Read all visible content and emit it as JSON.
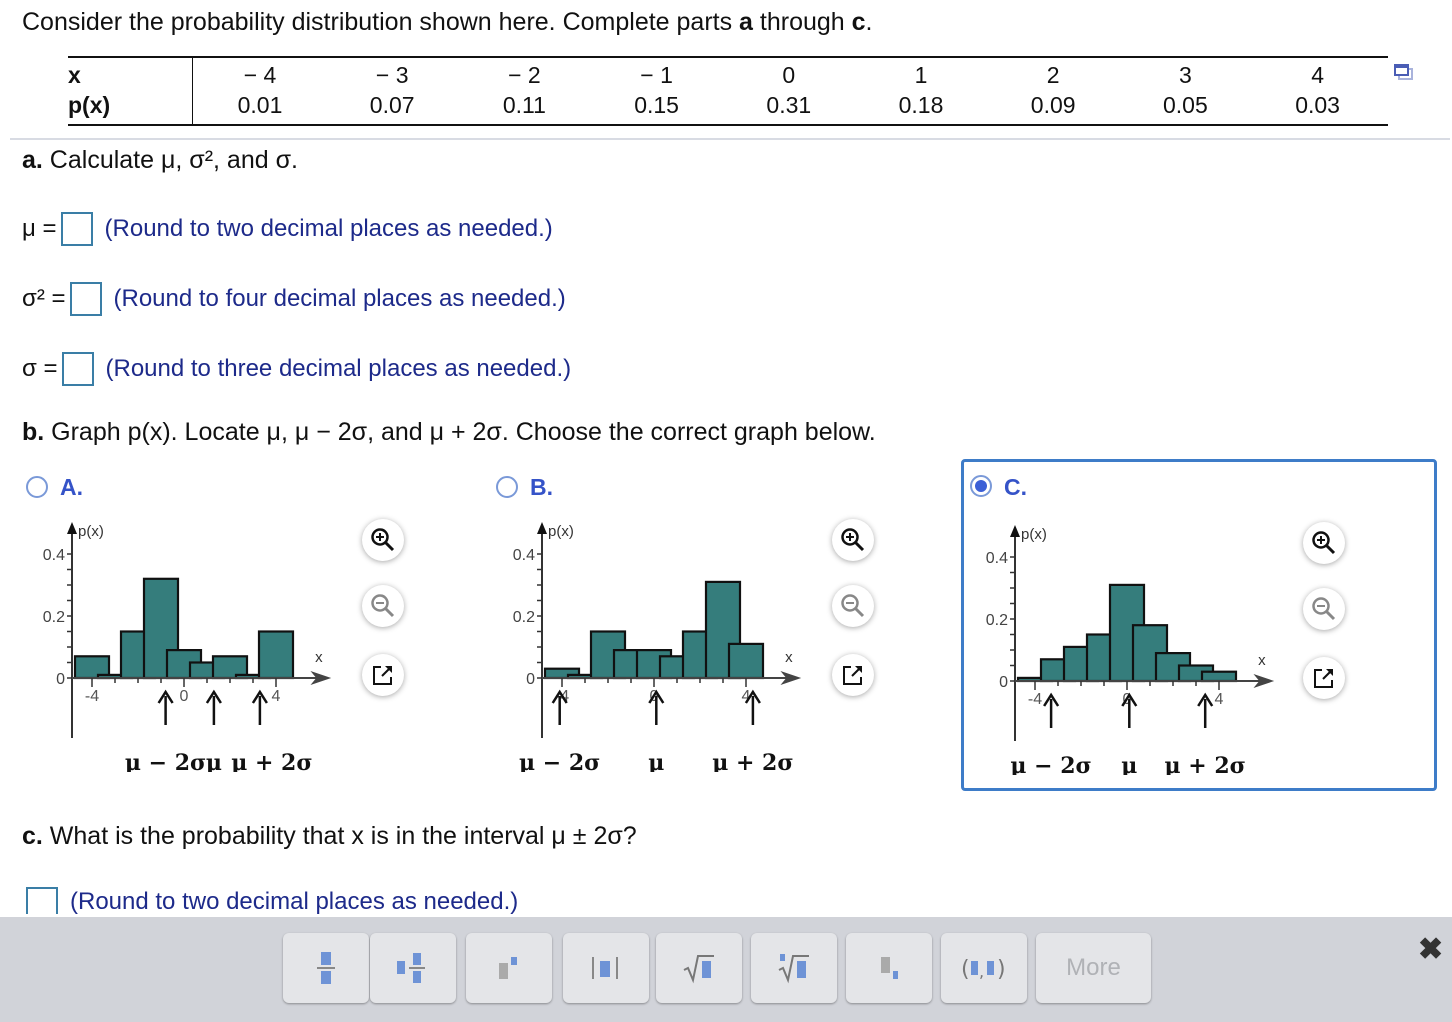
{
  "prompt": {
    "text_pre": "Consider the probability distribution shown here. Complete parts ",
    "a": "a",
    "mid": " through ",
    "c": "c",
    "end": "."
  },
  "table": {
    "x_header": "x",
    "p_header": "p(x)",
    "x_values": [
      "− 4",
      "− 3",
      "− 2",
      "− 1",
      "0",
      "1",
      "2",
      "3",
      "4"
    ],
    "p_values": [
      "0.01",
      "0.07",
      "0.11",
      "0.15",
      "0.31",
      "0.18",
      "0.09",
      "0.05",
      "0.03"
    ]
  },
  "part_a": {
    "label": "a.",
    "text": " Calculate μ, σ², and σ.",
    "rows": [
      {
        "label": "μ =",
        "value": "",
        "hint": "(Round to two decimal places as needed.)"
      },
      {
        "label": "σ² =",
        "value": "",
        "hint": "(Round to four decimal places as needed.)"
      },
      {
        "label": "σ =",
        "value": "",
        "hint": "(Round to three decimal places as needed.)"
      }
    ]
  },
  "part_b": {
    "label": "b.",
    "text": " Graph p(x). Locate μ, μ − 2σ, and μ + 2σ. Choose the correct graph below.",
    "selected": "C",
    "options": [
      {
        "letter": "A.",
        "selected": false
      },
      {
        "letter": "B.",
        "selected": false
      },
      {
        "letter": "C.",
        "selected": true
      }
    ]
  },
  "chart_data": [
    {
      "type": "bar",
      "title": "Option A",
      "categories": [
        -4,
        -3,
        -2,
        -1,
        0,
        1,
        2,
        3,
        4
      ],
      "values": [
        0.07,
        0.01,
        0.15,
        0.32,
        0.09,
        0.05,
        0.07,
        0.01,
        0.15
      ],
      "xlabel": "x",
      "ylabel": "p(x)",
      "ylim": [
        0,
        0.4
      ],
      "yticks": [
        "0",
        "0.2",
        "0.4"
      ],
      "xticks": [
        "-4",
        "0",
        "4"
      ],
      "markers": [
        {
          "label": "μ − 2σ",
          "x": -0.8
        },
        {
          "label": "μ",
          "x": 1.3
        },
        {
          "label": "μ + 2σ",
          "x": 3.3
        }
      ],
      "marker_caption": "μ − 2σ    μ μ + 2σ"
    },
    {
      "type": "bar",
      "title": "Option B",
      "categories": [
        -4,
        -3,
        -2,
        -1,
        0,
        1,
        2,
        3,
        4
      ],
      "values": [
        0.03,
        0.01,
        0.15,
        0.09,
        0.09,
        0.07,
        0.15,
        0.31,
        0.11
      ],
      "xlabel": "x",
      "ylabel": "p(x)",
      "ylim": [
        0,
        0.4
      ],
      "yticks": [
        "0",
        "0.2",
        "0.4"
      ],
      "xticks": [
        "-4",
        "0",
        "4"
      ],
      "markers": [
        {
          "label": "μ − 2σ",
          "x": -4.1
        },
        {
          "label": "μ",
          "x": 0.1
        },
        {
          "label": "μ + 2σ",
          "x": 4.3
        }
      ]
    },
    {
      "type": "bar",
      "title": "Option C",
      "categories": [
        -4,
        -3,
        -2,
        -1,
        0,
        1,
        2,
        3,
        4
      ],
      "values": [
        0.01,
        0.07,
        0.11,
        0.15,
        0.31,
        0.18,
        0.09,
        0.05,
        0.03
      ],
      "xlabel": "x",
      "ylabel": "p(x)",
      "ylim": [
        0,
        0.4
      ],
      "yticks": [
        "0",
        "0.2",
        "0.4"
      ],
      "xticks": [
        "-4",
        "0",
        "4"
      ],
      "markers": [
        {
          "label": "μ − 2σ",
          "x": -3.3
        },
        {
          "label": "μ",
          "x": 0.1
        },
        {
          "label": "μ + 2σ",
          "x": 3.4
        }
      ]
    }
  ],
  "graph_tools": {
    "zoom_in": "zoom-in",
    "zoom_out": "zoom-out",
    "popout": "open-in-new-window"
  },
  "part_c": {
    "label": "c.",
    "text": " What is the probability that x is in the interval μ ± 2σ?",
    "value": "",
    "hint": "(Round to two decimal places as needed.)"
  },
  "toolbar": {
    "buttons": [
      "fraction",
      "mixed-number",
      "exponent",
      "absolute-value",
      "square-root",
      "nth-root",
      "subscript",
      "ordered-pair"
    ],
    "more_label": "More",
    "close_label": "✖"
  },
  "colors": {
    "bar": "#357d7c",
    "accent": "#3553c8",
    "hint": "#1d2a8a",
    "selected_border": "#3e7cc8"
  }
}
